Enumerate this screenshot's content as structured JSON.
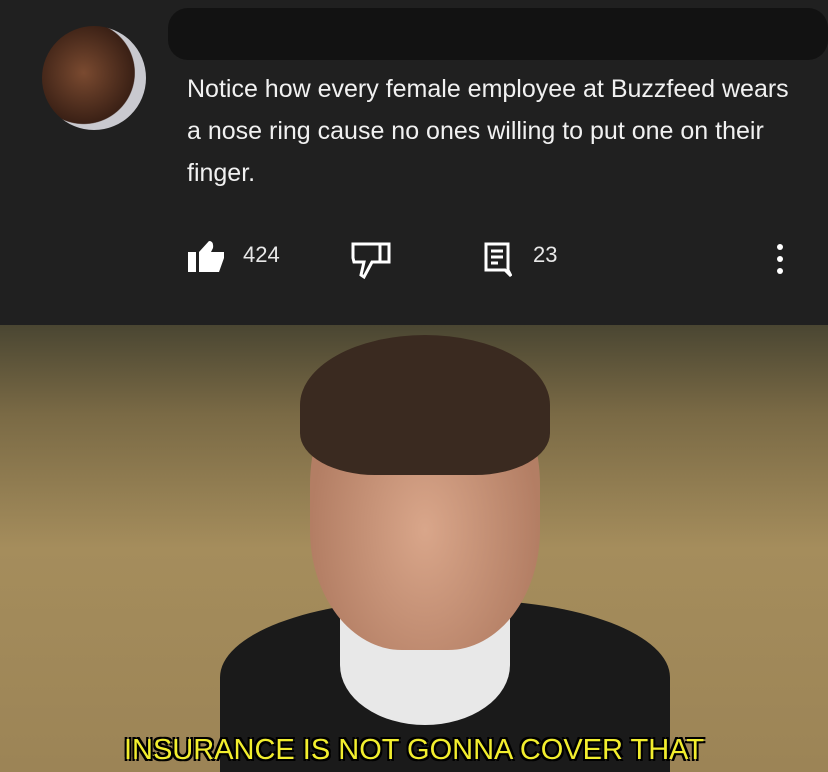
{
  "comment": {
    "text": "Notice how every female employee at Buzzfeed wears a nose ring cause no ones willing to put one on their finger.",
    "likes": "424",
    "replies": "23"
  },
  "icons": {
    "like": "thumbs-up-icon",
    "dislike": "thumbs-down-icon",
    "reply": "reply-icon",
    "more": "more-vert-icon"
  },
  "meme": {
    "subtitle": "INSURANCE IS NOT GONNA COVER THAT",
    "subtitle_color": "#f2ee2e"
  }
}
